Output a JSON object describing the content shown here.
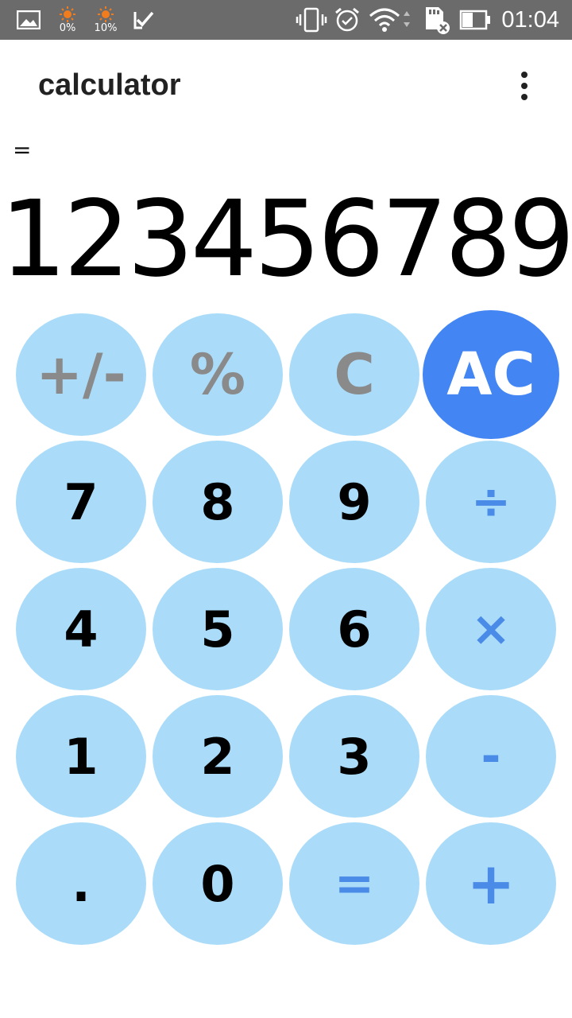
{
  "status_bar": {
    "battery_saver_1": "0%",
    "battery_saver_2": "10%",
    "time": "01:04",
    "icons": [
      "gallery-icon",
      "sun-icon",
      "sun-icon",
      "task-check-icon",
      "vibrate-icon",
      "alarm-icon",
      "wifi-icon",
      "sd-card-off-icon",
      "battery-icon"
    ]
  },
  "app": {
    "title": "calculator",
    "menu_icon": "more-vert-icon"
  },
  "display": {
    "expression": "=",
    "result": "123456789"
  },
  "colors": {
    "key_bg": "#aadcfa",
    "ac_bg": "#4386f3",
    "operator": "#4b8be8",
    "function": "#8a8a8a"
  },
  "keys": {
    "plus_minus": "+/-",
    "percent": "%",
    "clear": "C",
    "all_clear": "AC",
    "seven": "7",
    "eight": "8",
    "nine": "9",
    "divide": "÷",
    "four": "4",
    "five": "5",
    "six": "6",
    "multiply": "×",
    "one": "1",
    "two": "2",
    "three": "3",
    "minus": "-",
    "dot": ".",
    "zero": "0",
    "equals": "=",
    "plus": "+"
  }
}
